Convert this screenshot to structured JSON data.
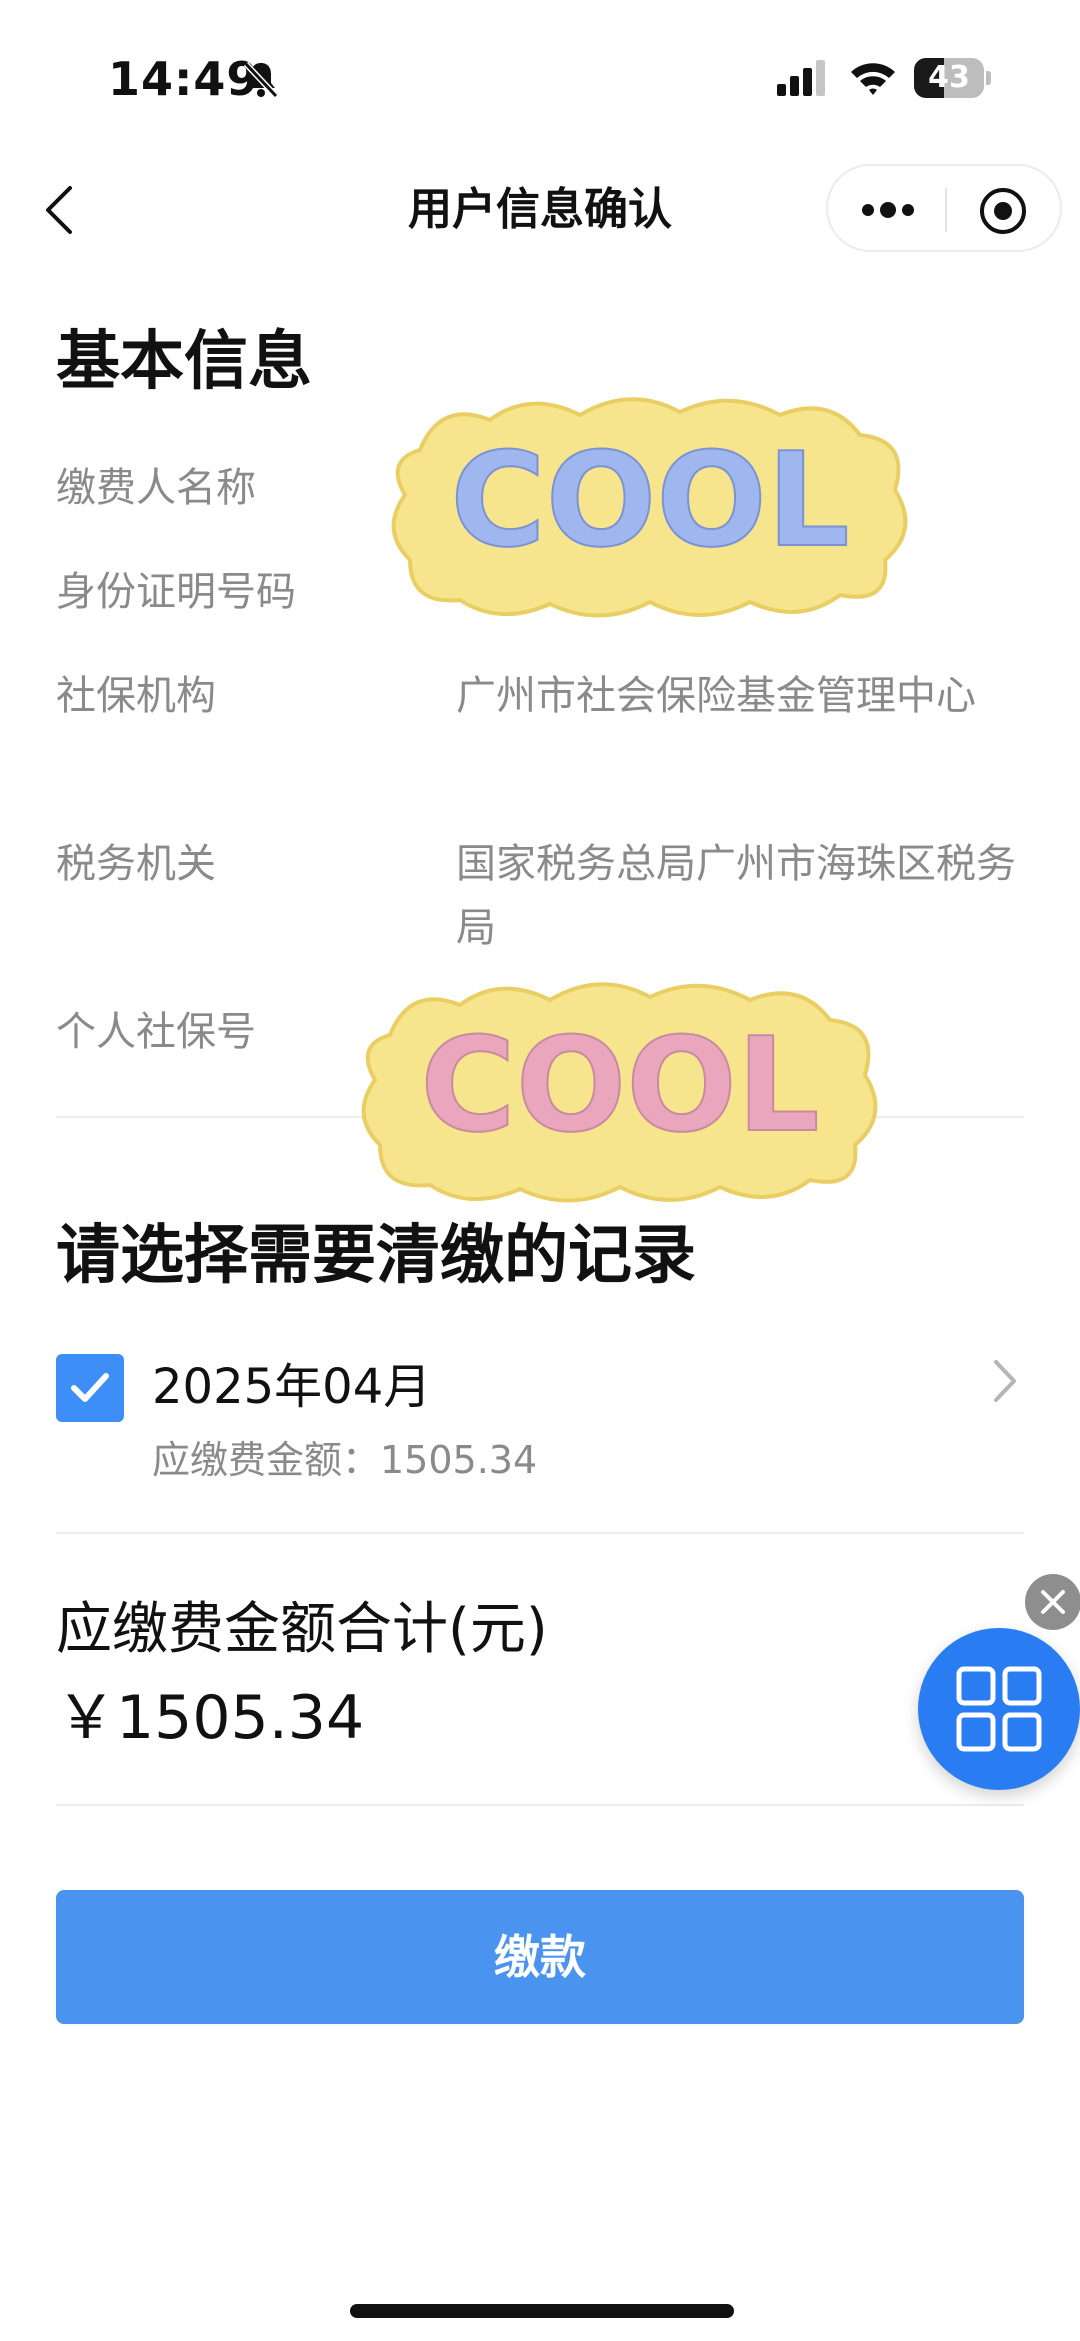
{
  "status_bar": {
    "time": "14:49",
    "battery_text": "43",
    "battery_level": 0.43,
    "icons": [
      "mute-bell-icon",
      "cellular-signal-icon",
      "wifi-icon",
      "battery-icon"
    ]
  },
  "nav": {
    "title": "用户信息确认",
    "icons": [
      "back-arrow-icon",
      "more-dots-icon",
      "target-icon"
    ]
  },
  "basic_info": {
    "title": "基本信息",
    "rows": [
      {
        "label": "缴费人名称",
        "value": ""
      },
      {
        "label": "身份证明号码",
        "value": ""
      },
      {
        "label": "社保机构",
        "value": "广州市社会保险基金管理中心"
      },
      {
        "label": "税务机关",
        "value": "国家税务总局广州市海珠区税务局"
      },
      {
        "label": "个人社保号",
        "value": ""
      }
    ]
  },
  "records": {
    "title": "请选择需要清缴的记录",
    "items": [
      {
        "month": "2025年04月",
        "amount_line": "应缴费金额：1505.34",
        "checked": true
      }
    ]
  },
  "total": {
    "label": "应缴费金额合计(元)",
    "value": "￥1505.34"
  },
  "pay_button": {
    "label": "缴款"
  },
  "stickers": [
    {
      "text": "COOL"
    },
    {
      "text": "COOL"
    }
  ],
  "floating": {
    "icons": [
      "close-icon",
      "grid-menu-icon"
    ]
  },
  "colors": {
    "accent": "#3E8EF7",
    "button": "#4A93EE",
    "float_button": "#2A7CF2",
    "label_gray": "#8A8A8A",
    "sticker_bg": "#F6E58D"
  }
}
